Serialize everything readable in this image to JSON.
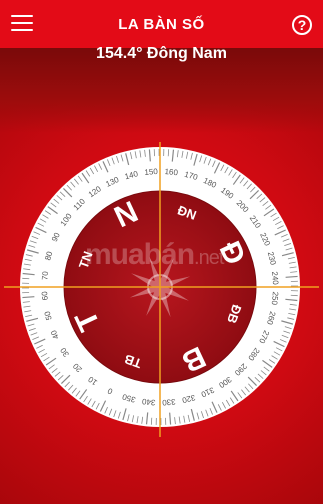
{
  "app": {
    "title": "LA BÀN SỐ"
  },
  "reading": {
    "heading_text": "154.4° Đông Nam"
  },
  "compass": {
    "bearing_deg": 154.4,
    "cardinals": [
      {
        "label": "N",
        "angle": 335
      },
      {
        "label": "T",
        "angle": 245
      },
      {
        "label": "B",
        "angle": 155
      },
      {
        "label": "Đ",
        "angle": 65
      }
    ],
    "intercardinals": [
      {
        "label": "TN",
        "angle": 290
      },
      {
        "label": "TB",
        "angle": 200
      },
      {
        "label": "ĐB",
        "angle": 110
      },
      {
        "label": "ĐN",
        "angle": 20
      }
    ],
    "tick_labels": [
      "0",
      "10",
      "20",
      "30",
      "40",
      "50",
      "60",
      "70",
      "80",
      "90",
      "100",
      "110",
      "120",
      "130",
      "140",
      "150",
      "160",
      "170",
      "180",
      "190",
      "200",
      "210",
      "220",
      "230",
      "240",
      "250",
      "260",
      "270",
      "280",
      "290",
      "300",
      "310",
      "320",
      "330",
      "340",
      "350"
    ],
    "colors": {
      "dial": "#ffffff",
      "face": "#a8121a",
      "crosshair": "#f0a020",
      "accent": "#e30b17"
    }
  },
  "watermark": {
    "brand": "muabán",
    "tld": ".net"
  }
}
